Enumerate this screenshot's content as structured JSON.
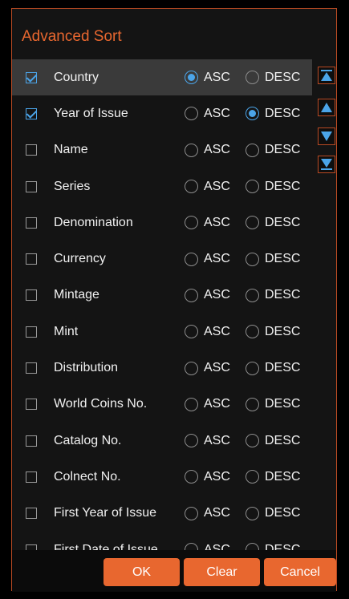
{
  "dialog": {
    "title": "Advanced Sort"
  },
  "options": {
    "asc": "ASC",
    "desc": "DESC"
  },
  "rows": [
    {
      "label": "Country",
      "checked": true,
      "order": "ASC"
    },
    {
      "label": "Year of Issue",
      "checked": true,
      "order": "DESC"
    },
    {
      "label": "Name",
      "checked": false,
      "order": ""
    },
    {
      "label": "Series",
      "checked": false,
      "order": ""
    },
    {
      "label": "Denomination",
      "checked": false,
      "order": ""
    },
    {
      "label": "Currency",
      "checked": false,
      "order": ""
    },
    {
      "label": "Mintage",
      "checked": false,
      "order": ""
    },
    {
      "label": "Mint",
      "checked": false,
      "order": ""
    },
    {
      "label": "Distribution",
      "checked": false,
      "order": ""
    },
    {
      "label": "World Coins No.",
      "checked": false,
      "order": ""
    },
    {
      "label": "Catalog No.",
      "checked": false,
      "order": ""
    },
    {
      "label": "Colnect No.",
      "checked": false,
      "order": ""
    },
    {
      "label": "First Year of Issue",
      "checked": false,
      "order": ""
    },
    {
      "label": "First Date of Issue",
      "checked": false,
      "order": ""
    }
  ],
  "move_buttons": {
    "icons": [
      "move-to-top-icon",
      "move-up-icon",
      "move-down-icon",
      "move-to-bottom-icon"
    ]
  },
  "footer": {
    "ok": "OK",
    "clear": "Clear",
    "cancel": "Cancel"
  },
  "colors": {
    "accent": "#e8672f",
    "border": "#b94a23",
    "selection": "#4ba4e8",
    "move_icon": "#4ba4e8"
  }
}
